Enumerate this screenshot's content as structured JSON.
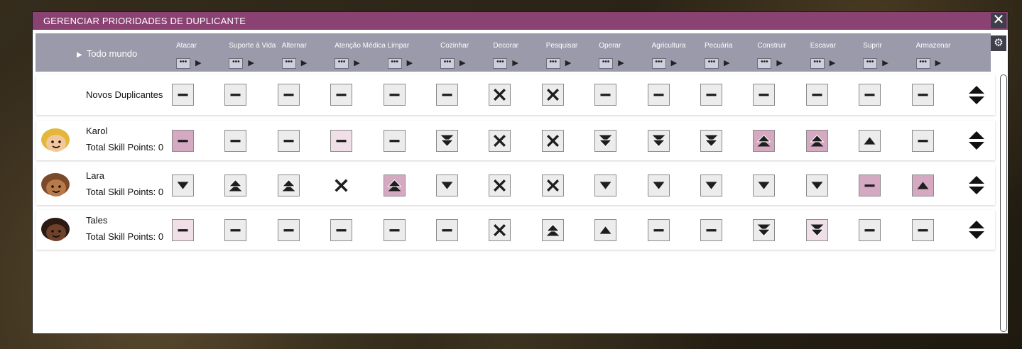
{
  "window": {
    "title": "GERENCIAR PRIORIDADES DE DUPLICANTE"
  },
  "header": {
    "everyone_label": "Todo mundo",
    "dots": "•••",
    "columns": [
      "Atacar",
      "Suporte à Vida",
      "Alternar",
      "Atenção Médica",
      "Limpar",
      "Cozinhar",
      "Decorar",
      "Pesquisar",
      "Operar",
      "Agricultura",
      "Pecuária",
      "Construir",
      "Escavar",
      "Suprir",
      "Armazenar"
    ]
  },
  "icons": {
    "close": "close-icon",
    "settings": "gear-icon",
    "swap": "sort-up-down-icon",
    "priorities": {
      "dash": "priority-normal-icon",
      "x": "priority-disabled-icon",
      "down": "priority-low-icon",
      "ddown": "priority-very-low-icon",
      "up": "priority-high-icon",
      "dup": "priority-very-high-icon"
    }
  },
  "colors": {
    "title_bar": "#8a4272",
    "header": "#9a9aaa",
    "highlight": "#d6a9c2"
  },
  "rows": [
    {
      "name": "Novos Duplicantes",
      "skill_points": "",
      "cells": [
        {
          "p": "dash",
          "s": ""
        },
        {
          "p": "dash",
          "s": ""
        },
        {
          "p": "dash",
          "s": ""
        },
        {
          "p": "dash",
          "s": ""
        },
        {
          "p": "dash",
          "s": ""
        },
        {
          "p": "dash",
          "s": ""
        },
        {
          "p": "x",
          "s": ""
        },
        {
          "p": "x",
          "s": ""
        },
        {
          "p": "dash",
          "s": ""
        },
        {
          "p": "dash",
          "s": ""
        },
        {
          "p": "dash",
          "s": ""
        },
        {
          "p": "dash",
          "s": ""
        },
        {
          "p": "dash",
          "s": ""
        },
        {
          "p": "dash",
          "s": ""
        },
        {
          "p": "dash",
          "s": ""
        }
      ]
    },
    {
      "name": "Karol",
      "skill_points": "Total Skill Points: 0",
      "cells": [
        {
          "p": "dash",
          "s": "hl"
        },
        {
          "p": "dash",
          "s": ""
        },
        {
          "p": "dash",
          "s": ""
        },
        {
          "p": "dash",
          "s": "pink-light"
        },
        {
          "p": "dash",
          "s": ""
        },
        {
          "p": "ddown",
          "s": ""
        },
        {
          "p": "x",
          "s": ""
        },
        {
          "p": "x",
          "s": ""
        },
        {
          "p": "ddown",
          "s": ""
        },
        {
          "p": "ddown",
          "s": ""
        },
        {
          "p": "ddown",
          "s": ""
        },
        {
          "p": "dup",
          "s": "hl"
        },
        {
          "p": "dup",
          "s": "hl"
        },
        {
          "p": "up",
          "s": ""
        },
        {
          "p": "dash",
          "s": ""
        }
      ]
    },
    {
      "name": "Lara",
      "skill_points": "Total Skill Points: 0",
      "cells": [
        {
          "p": "down",
          "s": ""
        },
        {
          "p": "dup",
          "s": ""
        },
        {
          "p": "dup",
          "s": ""
        },
        {
          "p": "x",
          "s": "none"
        },
        {
          "p": "dup",
          "s": "hl"
        },
        {
          "p": "down",
          "s": ""
        },
        {
          "p": "x",
          "s": ""
        },
        {
          "p": "x",
          "s": ""
        },
        {
          "p": "down",
          "s": ""
        },
        {
          "p": "down",
          "s": ""
        },
        {
          "p": "down",
          "s": ""
        },
        {
          "p": "down",
          "s": ""
        },
        {
          "p": "down",
          "s": ""
        },
        {
          "p": "dash",
          "s": "hl"
        },
        {
          "p": "up",
          "s": "hl"
        }
      ]
    },
    {
      "name": "Tales",
      "skill_points": "Total Skill Points: 0",
      "cells": [
        {
          "p": "dash",
          "s": "pink-light"
        },
        {
          "p": "dash",
          "s": ""
        },
        {
          "p": "dash",
          "s": ""
        },
        {
          "p": "dash",
          "s": ""
        },
        {
          "p": "dash",
          "s": ""
        },
        {
          "p": "dash",
          "s": ""
        },
        {
          "p": "x",
          "s": ""
        },
        {
          "p": "dup",
          "s": ""
        },
        {
          "p": "up",
          "s": ""
        },
        {
          "p": "dash",
          "s": ""
        },
        {
          "p": "dash",
          "s": ""
        },
        {
          "p": "ddown",
          "s": ""
        },
        {
          "p": "ddown",
          "s": "pink-light"
        },
        {
          "p": "dash",
          "s": ""
        },
        {
          "p": "dash",
          "s": ""
        }
      ]
    }
  ]
}
